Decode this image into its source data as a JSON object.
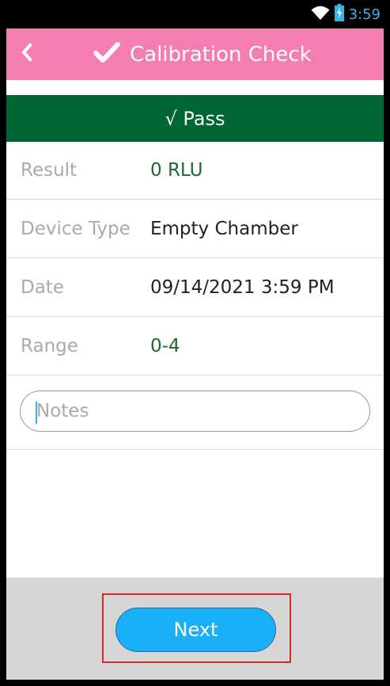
{
  "status_bar": {
    "time": "3:59",
    "icons": [
      "wifi-icon",
      "battery-charging-icon"
    ]
  },
  "app_bar": {
    "back_icon": "chevron-left-icon",
    "title_icon": "checkmark-icon",
    "title": "Calibration Check"
  },
  "banner": {
    "text": "√ Pass",
    "color": "#006633"
  },
  "details": [
    {
      "label": "Result",
      "value": "0 RLU"
    },
    {
      "label": "Device Type",
      "value": "Empty Chamber"
    },
    {
      "label": "Date",
      "value": "09/14/2021 3:59 PM"
    },
    {
      "label": "Range",
      "value": "0-4"
    }
  ],
  "notes": {
    "placeholder": "Notes",
    "value": ""
  },
  "footer": {
    "next_label": "Next"
  },
  "colors": {
    "app_bar": "#f47db1",
    "accent": "#1ab0f7",
    "success": "#1a6b2e",
    "highlight_box": "#e0252b"
  }
}
